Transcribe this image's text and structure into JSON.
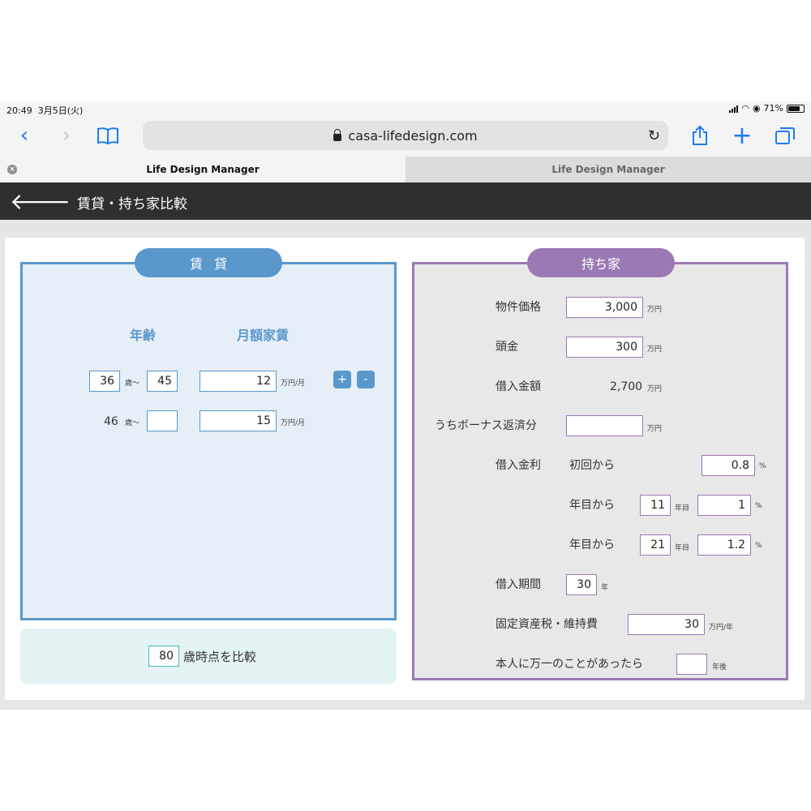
{
  "status": {
    "time": "20:49",
    "date": "3月5日(火)",
    "battery": "71%"
  },
  "browser": {
    "url": "casa-lifedesign.com"
  },
  "tabs": [
    {
      "label": "Life Design Manager"
    },
    {
      "label": "Life Design Manager"
    }
  ],
  "app": {
    "title": "賃貸・持ち家比較"
  },
  "rent": {
    "title": "賃貸",
    "age_header": "年齢",
    "rent_header": "月額家賃",
    "age_unit": "歳〜",
    "rent_unit": "万円/月",
    "rows": [
      {
        "from": "36",
        "to": "45",
        "rent": "12"
      },
      {
        "from": "46",
        "to": "",
        "rent": "15"
      }
    ],
    "add_label": "+",
    "remove_label": "-"
  },
  "compare": {
    "age": "80",
    "label": "歳時点を比較"
  },
  "own": {
    "title": "持ち家",
    "price_label": "物件価格",
    "price": "3,000",
    "price_unit": "万円",
    "down_label": "頭金",
    "down": "300",
    "down_unit": "万円",
    "loan_label": "借入金額",
    "loan": "2,700",
    "loan_unit": "万円",
    "bonus_label": "うちボーナス返済分",
    "bonus": "",
    "bonus_unit": "万円",
    "rate_label": "借入金利",
    "rate_first_label": "初回から",
    "rate_first": "0.8",
    "rate_unit": "%",
    "rate_step_label": "年目から",
    "year_unit": "年目",
    "rate_step1_year": "11",
    "rate_step1": "1",
    "rate_step2_year": "21",
    "rate_step2": "1.2",
    "term_label": "借入期間",
    "term": "30",
    "term_unit": "年",
    "tax_label": "固定資産税・維持費",
    "tax": "30",
    "tax_unit": "万円/年",
    "death_label": "本人に万一のことがあったら",
    "death": "",
    "death_unit": "年後"
  }
}
